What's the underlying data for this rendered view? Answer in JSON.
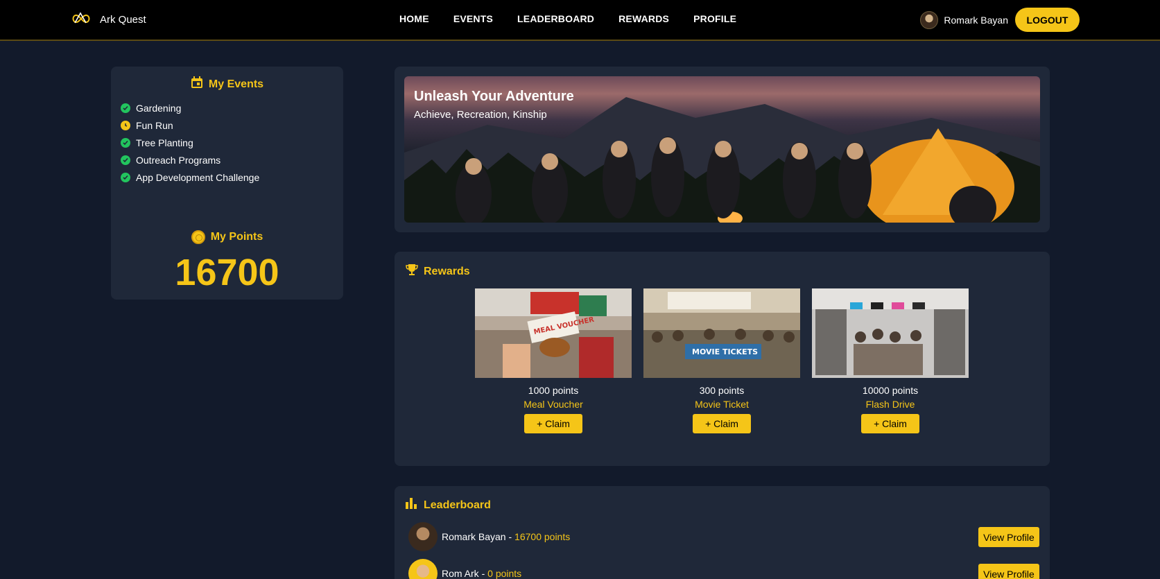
{
  "brand": {
    "name": "Ark Quest",
    "logo_icon": "infinity-loop-icon"
  },
  "nav": {
    "links": [
      "HOME",
      "EVENTS",
      "LEADERBOARD",
      "REWARDS",
      "PROFILE"
    ]
  },
  "user": {
    "name": "Romark Bayan",
    "logout_label": "LOGOUT"
  },
  "my_events": {
    "title": "My Events",
    "items": [
      {
        "label": "Gardening",
        "status": "completed"
      },
      {
        "label": "Fun Run",
        "status": "pending"
      },
      {
        "label": "Tree Planting",
        "status": "completed"
      },
      {
        "label": "Outreach Programs",
        "status": "completed"
      },
      {
        "label": "App Development Challenge",
        "status": "completed"
      }
    ]
  },
  "my_points": {
    "title": "My Points",
    "value": "16700"
  },
  "hero": {
    "title": "Unleash Your Adventure",
    "subtitle": "Achieve, Recreation, Kinship"
  },
  "rewards": {
    "title": "Rewards",
    "items": [
      {
        "points": "1000 points",
        "name": "Meal Voucher",
        "claim_label": "+ Claim",
        "image_text": "MEAL VOUCHER"
      },
      {
        "points": "300 points",
        "name": "Movie Ticket",
        "claim_label": "+ Claim",
        "image_text": "MOVIE TICKETS"
      },
      {
        "points": "10000 points",
        "name": "Flash Drive",
        "claim_label": "+ Claim",
        "image_text": ""
      }
    ]
  },
  "leaderboard": {
    "title": "Leaderboard",
    "rows": [
      {
        "name": "Romark Bayan",
        "separator": " - ",
        "points": "16700 points",
        "button": "View Profile"
      },
      {
        "name": "Rom Ark",
        "separator": " - ",
        "points": "0 points",
        "button": "View Profile"
      }
    ]
  },
  "colors": {
    "accent": "#f5c518",
    "background": "#121a2b",
    "card": "#1f2839",
    "success": "#22c55e"
  }
}
